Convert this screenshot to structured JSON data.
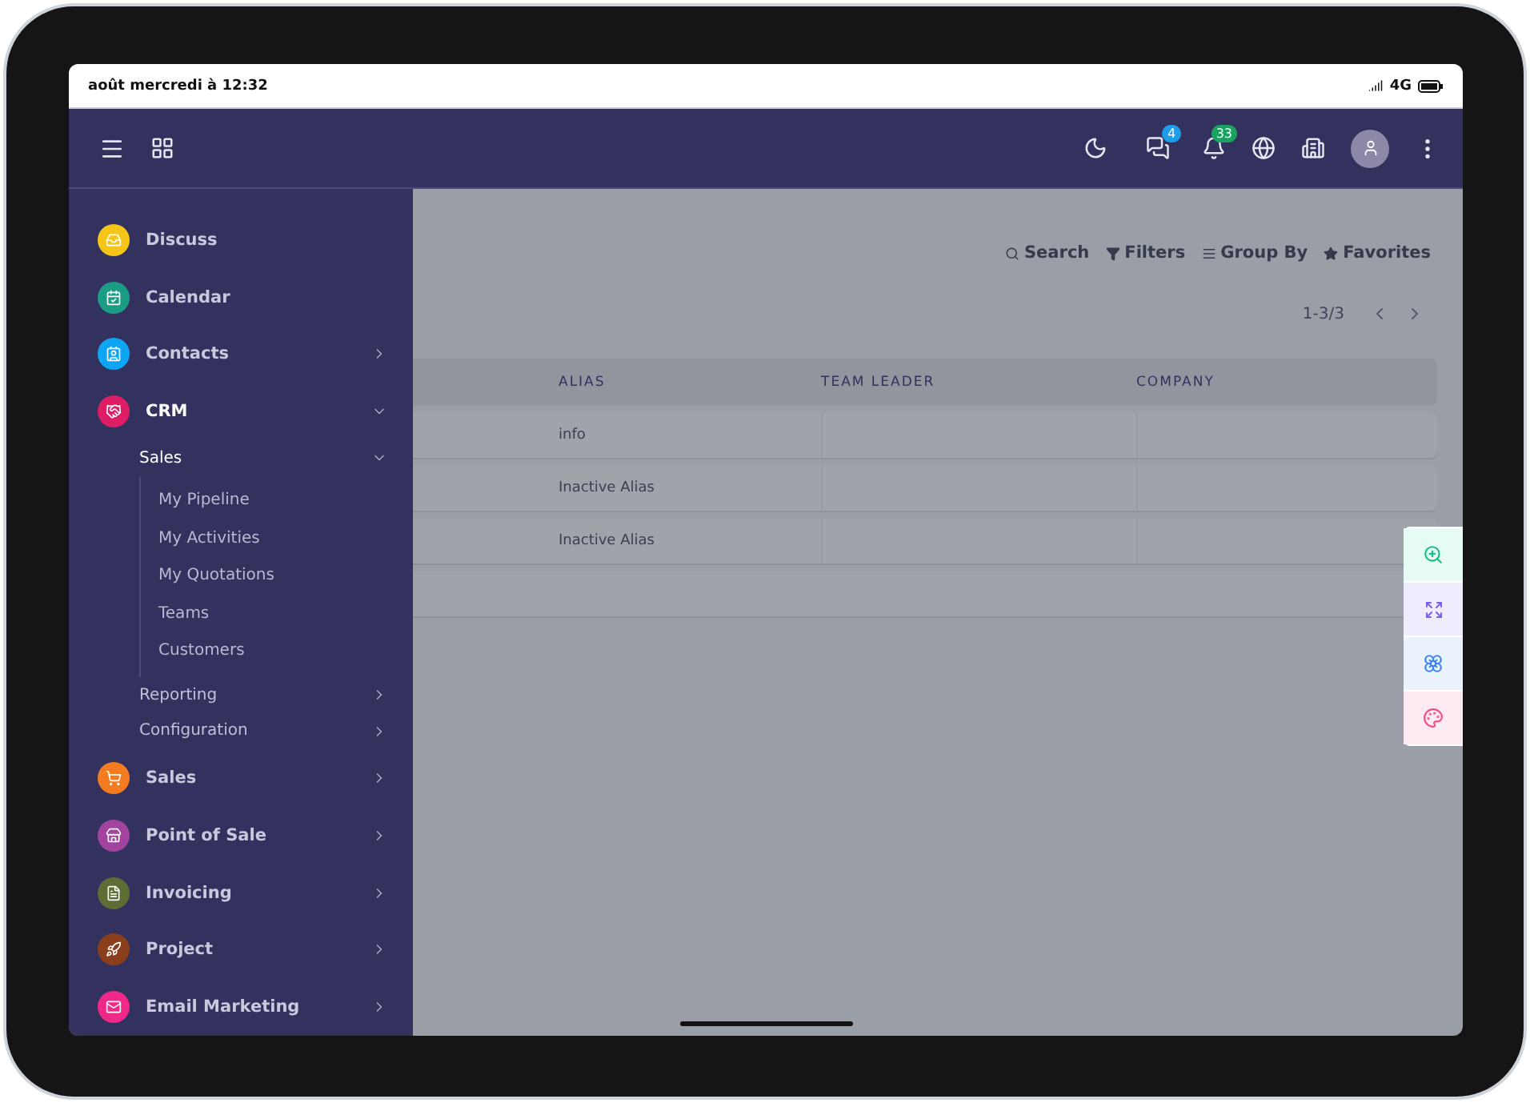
{
  "status_bar": {
    "time": "août mercredi à 12:32",
    "network": "4G"
  },
  "header": {
    "messages_badge": "4",
    "notifications_badge": "33"
  },
  "sidebar": {
    "items": [
      {
        "label": "Discuss",
        "color": "#f5c518"
      },
      {
        "label": "Calendar",
        "color": "#1b9c85"
      },
      {
        "label": "Contacts",
        "color": "#0ea5f5",
        "expanded": false
      },
      {
        "label": "CRM",
        "color": "#dd1d64",
        "expanded": true,
        "children": [
          {
            "label": "Sales",
            "expanded": true,
            "children": [
              {
                "label": "My Pipeline"
              },
              {
                "label": "My Activities"
              },
              {
                "label": "My Quotations"
              },
              {
                "label": "Teams"
              },
              {
                "label": "Customers"
              }
            ]
          },
          {
            "label": "Reporting",
            "expanded": false
          },
          {
            "label": "Configuration",
            "expanded": false
          }
        ]
      },
      {
        "label": "Sales",
        "color": "#f47c20",
        "expanded": false
      },
      {
        "label": "Point of Sale",
        "color": "#a2449f",
        "expanded": false
      },
      {
        "label": "Invoicing",
        "color": "#5d6e35",
        "expanded": false
      },
      {
        "label": "Project",
        "color": "#8b3e1c",
        "expanded": false
      },
      {
        "label": "Email Marketing",
        "color": "#f0288a",
        "expanded": false
      }
    ]
  },
  "search_bar": [
    {
      "kind": "search",
      "label": "Search"
    },
    {
      "kind": "filter",
      "label": "Filters"
    },
    {
      "kind": "group",
      "label": "Group By"
    },
    {
      "kind": "favorite",
      "label": "Favorites"
    }
  ],
  "pager": "1-3/3",
  "table": {
    "columns": [
      "ALIAS",
      "TEAM LEADER",
      "COMPANY"
    ],
    "rows": [
      [
        "info",
        "",
        ""
      ],
      [
        "Inactive Alias",
        "",
        ""
      ],
      [
        "Inactive Alias",
        "",
        ""
      ]
    ]
  }
}
